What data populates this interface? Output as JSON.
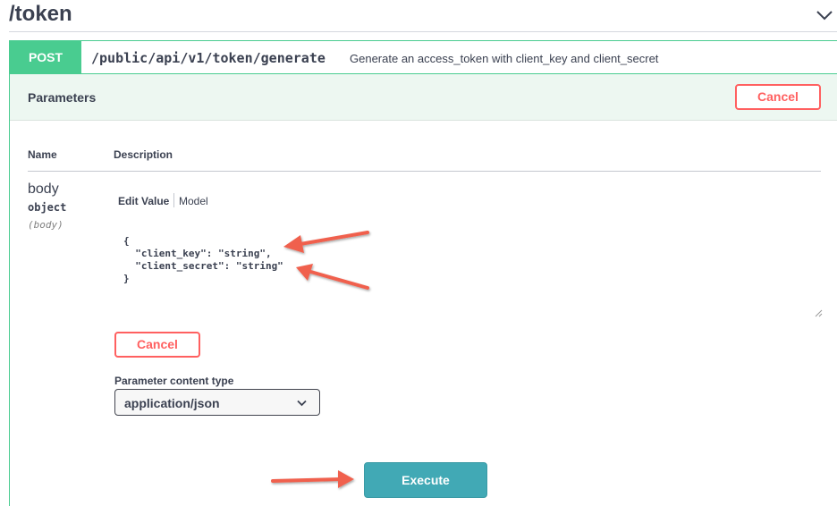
{
  "tag": {
    "title": "/token",
    "chevron_icon": "chevron-down-icon"
  },
  "operation": {
    "method": "POST",
    "path": "/public/api/v1/token/generate",
    "summary": "Generate an access_token with client_key and client_secret",
    "method_color": "#49cc90"
  },
  "parameters": {
    "title": "Parameters",
    "cancel_label": "Cancel",
    "columns": {
      "name": "Name",
      "description": "Description"
    },
    "param": {
      "name": "body",
      "type": "object",
      "in": "(body)"
    },
    "tabs": {
      "edit_value": "Edit Value",
      "model": "Model"
    },
    "editor_value": "{\n  \"client_key\": \"string\",\n  \"client_secret\": \"string\"\n}",
    "body_cancel_label": "Cancel",
    "content_type_label": "Parameter content type",
    "content_type_value": "application/json"
  },
  "execute_label": "Execute",
  "colors": {
    "cancel": "#ff6060",
    "execute": "#41a9b5",
    "params_bg": "#edf7f1",
    "arrow": "#f0614e"
  }
}
